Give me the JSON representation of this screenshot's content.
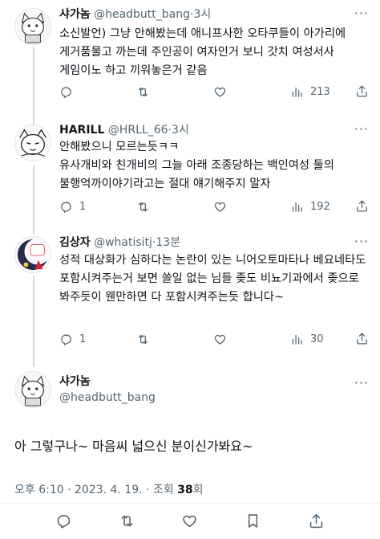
{
  "tweets": [
    {
      "name": "샤가놈",
      "handle": "@headbutt_bang",
      "time": "3시",
      "dot": "·",
      "text": "소신발언) 그냥 안해봤는데 애니프사한 오타쿠들이 아가리에 게거품물고 까는데 주인공이 여자인거 보니 갓치 여성서사 게임이노 하고 끼워놓은거 같음",
      "replies": "",
      "retweets": "",
      "likes": "",
      "views": "213"
    },
    {
      "name": "HARILL",
      "handle": "@HRLL_66",
      "time": "3시",
      "dot": "·",
      "text": "안해봤으니 모르는듯ㅋㅋ\n유사개비와 친개비의 그늘 아래 조종당하는 백인여성 둘의 불행억까이야기라고는 절대 얘기해주지 말자",
      "replies": "1",
      "retweets": "",
      "likes": "",
      "views": "192"
    },
    {
      "name": "김상자",
      "handle": "@whatisitj",
      "time": "13분",
      "dot": "·",
      "text": "성적 대상화가 심하다는 논란이 있는 니어오토마타나 베요네타도 포함시켜주는거 보면 쓸일 없는 님들 좆도 비뇨기과에서 좆으로 봐주듯이 웬만하면 다 포함시켜주는듯 합니다~",
      "replies": "1",
      "retweets": "",
      "likes": "",
      "views": "30"
    }
  ],
  "main": {
    "name": "샤가놈",
    "handle": "@headbutt_bang",
    "text": "아 그렇구나~ 마음씨 넓으신 분이신가봐요~",
    "meta_time": "오후 6:10 · 2023. 4. 19. · 조회 ",
    "meta_views": "38",
    "meta_suffix": "회"
  },
  "more_label": "···",
  "icons": {
    "reply": "reply-icon",
    "retweet": "retweet-icon",
    "like": "heart-icon",
    "views": "views-icon",
    "share": "share-icon",
    "bookmark": "bookmark-icon"
  },
  "colors": {
    "text": "#0f1419",
    "secondary": "#536471",
    "separator": "#eff3f4",
    "thread_line": "#cfd9de"
  }
}
